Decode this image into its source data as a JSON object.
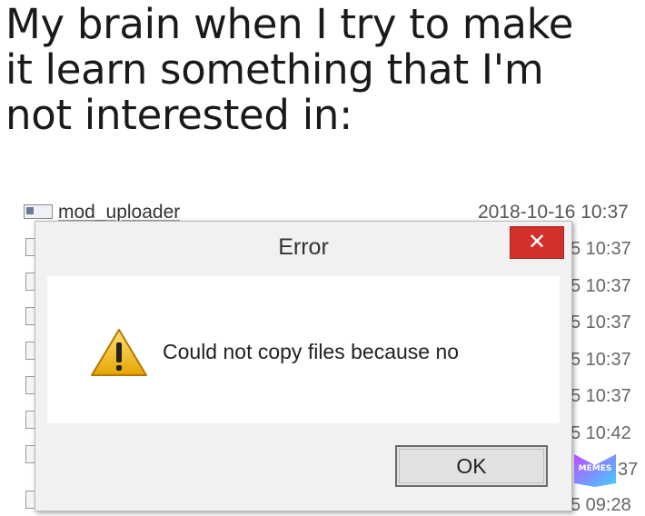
{
  "caption": {
    "line1": "My brain when I try to make",
    "line2": "it learn something that I'm",
    "line3": "not interested in:"
  },
  "explorer": {
    "file_name": "mod_uploader",
    "file_date": "2018-10-16 10:37",
    "times": [
      "5 10:37",
      "5 10:37",
      "5 10:37",
      "5 10:37",
      "5 10:37",
      "5 10:42",
      "37",
      "5 09:28"
    ]
  },
  "dialog": {
    "title": "Error",
    "close_glyph": "✕",
    "message": "Could not copy files because no",
    "ok_label": "OK",
    "icon": "warning-icon",
    "close_color": "#d2302b"
  },
  "watermark": {
    "text": "MEMES",
    "icon": "memes-logo-icon"
  }
}
